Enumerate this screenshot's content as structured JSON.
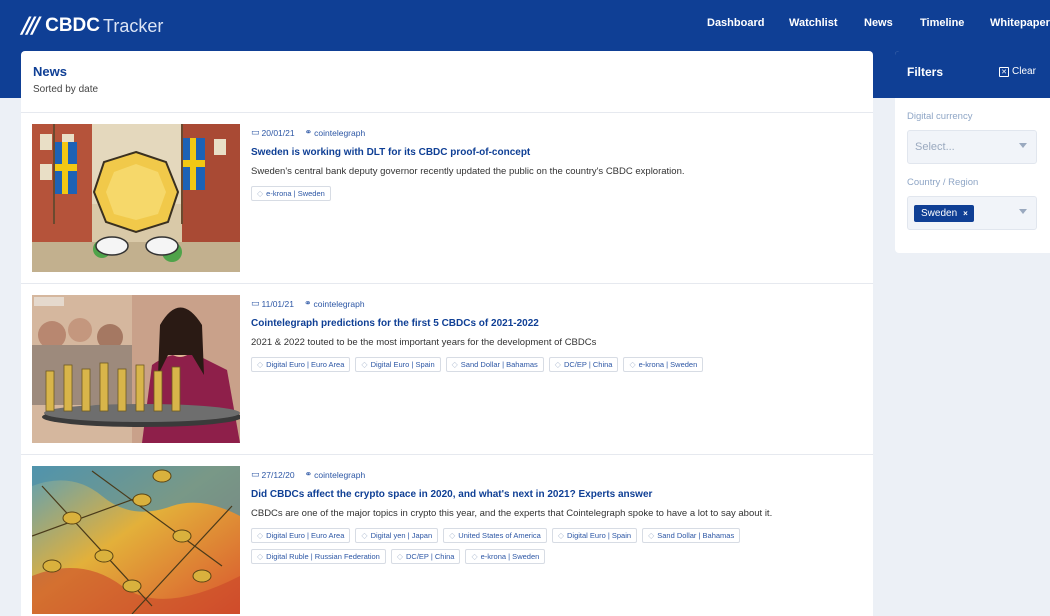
{
  "brand": {
    "mark": "///",
    "name_bold": "CBDC",
    "name_light": "Tracker"
  },
  "nav": [
    {
      "label": "Dashboard"
    },
    {
      "label": "Watchlist"
    },
    {
      "label": "News"
    },
    {
      "label": "Timeline"
    },
    {
      "label": "Whitepaper"
    }
  ],
  "news": {
    "title": "News",
    "subtitle": "Sorted by date",
    "articles": [
      {
        "date": "20/01/21",
        "source": "cointelegraph",
        "title": "Sweden is working with DLT for its CBDC proof-of-concept",
        "description": "Sweden's central bank deputy governor recently updated the public on the country's CBDC exploration.",
        "tags": [
          "e-krona | Sweden"
        ]
      },
      {
        "date": "11/01/21",
        "source": "cointelegraph",
        "title": "Cointelegraph predictions for the first 5 CBDCs of 2021-2022",
        "description": "2021 & 2022 touted to be the most important years for the development of CBDCs",
        "tags": [
          "Digital Euro | Euro Area",
          "Digital Euro | Spain",
          "Sand Dollar | Bahamas",
          "DC/EP | China",
          "e-krona | Sweden"
        ]
      },
      {
        "date": "27/12/20",
        "source": "cointelegraph",
        "title": "Did CBDCs affect the crypto space in 2020, and what's next in 2021? Experts answer",
        "description": "CBDCs are one of the major topics in crypto this year, and the experts that Cointelegraph spoke to have a lot to say about it.",
        "tags": [
          "Digital Euro | Euro Area",
          "Digital yen | Japan",
          "United States of America",
          "Digital Euro | Spain",
          "Sand Dollar | Bahamas",
          "Digital Ruble | Russian Federation",
          "DC/EP | China",
          "e-krona | Sweden"
        ]
      }
    ]
  },
  "filters": {
    "title": "Filters",
    "clear_label": "Clear",
    "digital_currency": {
      "label": "Digital currency",
      "placeholder": "Select..."
    },
    "country": {
      "label": "Country / Region",
      "selected": "Sweden",
      "remove": "×"
    }
  },
  "icons": {
    "calendar": "calendar-icon",
    "link": "link-icon",
    "tag": "tag-icon",
    "clear": "close-box-icon",
    "caret": "chevron-down-icon"
  },
  "colors": {
    "primary": "#0f3f95",
    "link": "#2d57a5",
    "background": "#ecf0f6"
  }
}
